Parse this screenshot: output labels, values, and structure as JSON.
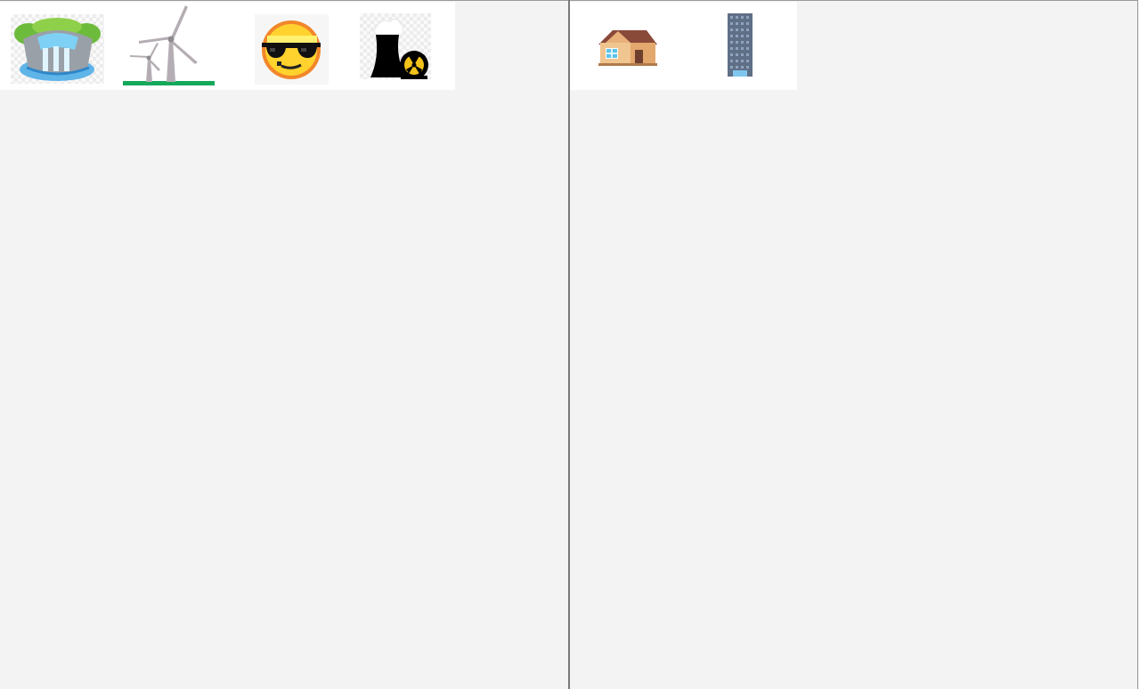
{
  "source_palette": {
    "items": [
      {
        "icon": "hydroelectric-dam-icon"
      },
      {
        "icon": "wind-turbine-icon"
      },
      {
        "icon": "solar-sun-sunglasses-icon"
      },
      {
        "icon": "nuclear-plant-icon"
      }
    ]
  },
  "consumer_palette": {
    "items": [
      {
        "icon": "house-icon"
      },
      {
        "icon": "skyscraper-icon"
      }
    ]
  },
  "colors": {
    "workspace_bg": "#f3f3f3",
    "palette_bg": "#ffffff",
    "divider": "#7a7a7a"
  }
}
